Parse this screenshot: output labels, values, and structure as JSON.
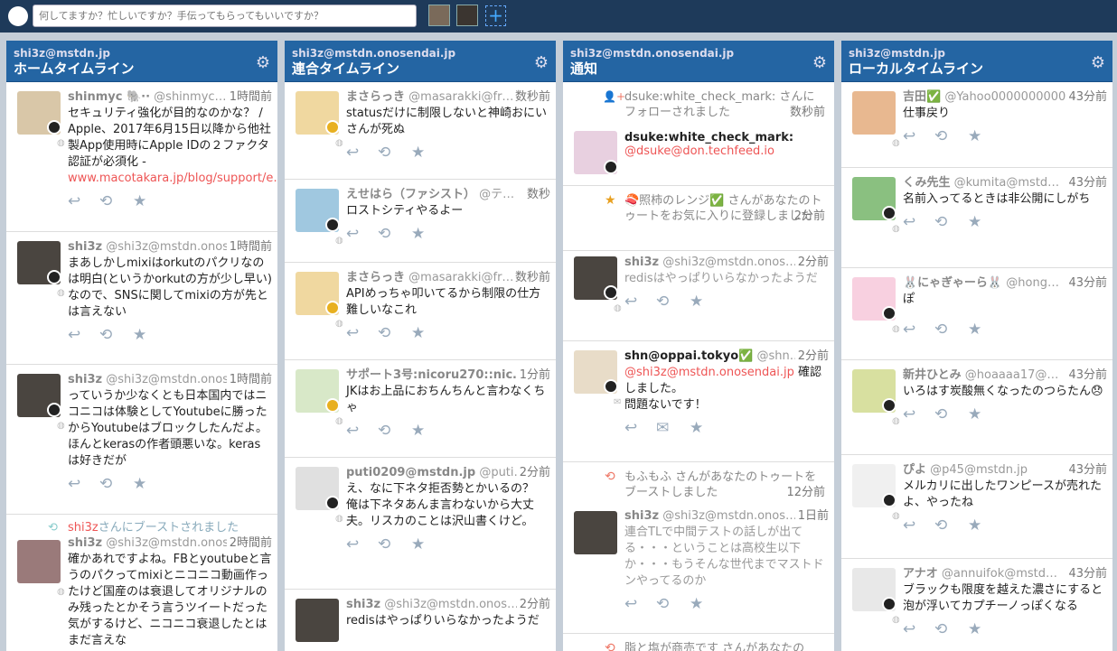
{
  "search": {
    "placeholder": "何してますか？忙しいですか？手伝ってもらってもいいですか？"
  },
  "columns": [
    {
      "account": "shi3z@mstdn.jp",
      "title": "ホームタイムライン"
    },
    {
      "account": "shi3z@mstdn.onosendai.jp",
      "title": "連合タイムライン"
    },
    {
      "account": "shi3z@mstdn.onosendai.jp",
      "title": "通知"
    },
    {
      "account": "shi3z@mstdn.jp",
      "title": "ローカルタイムライン"
    }
  ],
  "home": [
    {
      "name": "shinmyc 🐘··",
      "handle": "@shinmyc…",
      "time": "1時間前",
      "text": "セキュリティ強化が目的なのかな？ / Apple、2017年6月15日以降から他社製App使用時にApple IDの２ファクタ認証が必須化 - ",
      "link": "www.macotakara.jp/blog/support/e…"
    },
    {
      "name": "shi3z",
      "handle": "@shi3z@mstdn.onos…",
      "time": "1時間前",
      "text": "まあしかしmixiはorkutのパクリなのは明白(というかorkutの方が少し早い)なので、SNSに関してmixiの方が先とは言えない"
    },
    {
      "name": "shi3z",
      "handle": "@shi3z@mstdn.onos…",
      "time": "1時間前",
      "text": "っていうか少なくとも日本国内ではニコニコは体験としてYoutubeに勝ったからYoutubeはブロックしたんだよ。ほんとkerasの作者頭悪いな。kerasは好きだが"
    },
    {
      "boost_user": "shi3z",
      "boost_text": "さんにブーストされました",
      "name": "shi3z",
      "handle": "@shi3z@mstdn.onos…",
      "time": "2時間前",
      "text": "確かあれですよね。FBとyoutubeと言うのパクってmixiとニコニコ動画作ったけど国産のは衰退してオリジナルのみ残ったとかそう言うツイートだった気がするけど、ニコニコ衰退したとはまだ言えな"
    }
  ],
  "federated": [
    {
      "name": "まさらっき",
      "handle": "@masarakki@fr…",
      "time": "数秒前",
      "text": "statusだけに制限しないと神崎おにいさんが死ぬ"
    },
    {
      "name": "えせはら（ファシスト）",
      "handle": "@テ…",
      "time": "数秒",
      "text": "ロストシティやるよー"
    },
    {
      "name": "まさらっき",
      "handle": "@masarakki@fr…",
      "time": "数秒前",
      "text": "APIめっちゃ叩いてるから制限の仕方難しいなこれ"
    },
    {
      "name": "サポート3号:nicoru270::nic…",
      "handle": "",
      "time": "1分前",
      "text": "JKはお上品におちんちんと言わなくちゃ"
    },
    {
      "name": "puti0209@mstdn.jp",
      "handle": "@puti…",
      "time": "2分前",
      "text": "え、なに下ネタ拒否勢とかいるの？　俺は下ネタあんま言わないから大丈夫。リスカのことは沢山書くけど。"
    },
    {
      "name": "shi3z",
      "handle": "@shi3z@mstdn.onos…",
      "time": "2分前",
      "text": "redisはやっぱりいらなかったようだ"
    }
  ],
  "notifications": [
    {
      "type": "follow",
      "text": "dsuke:white_check_mark: さんにフォローされました",
      "time": "数秒前"
    },
    {
      "type": "account",
      "name": "dsuke:white_check_mark:",
      "handle": "@dsuke@don.techfeed.io"
    },
    {
      "type": "favourite",
      "text": "🍣照柿のレンジ✅ さんがあなたのトゥートをお気に入りに登録しました",
      "time": "2分前"
    },
    {
      "type": "status",
      "name": "shi3z",
      "handle": "@shi3z@mstdn.onos…",
      "time": "2分前",
      "text": "redisはやっぱりいらなかったようだ"
    },
    {
      "type": "mention",
      "name": "shn@oppai.tokyo✅",
      "handle": "@shn…",
      "time": "2分前",
      "mention": "@shi3z@mstdn.onosendai.jp",
      "text": " 確認しました。\n問題ないです！"
    },
    {
      "type": "reblog",
      "text": "もふもふ さんがあなたのトゥートをブーストしました",
      "time": "12分前"
    },
    {
      "type": "status",
      "name": "shi3z",
      "handle": "@shi3z@mstdn.onos…",
      "time": "1日前",
      "text": "連合TLで中間テストの話しが出てる・・・ということは高校生以下か・・・もうそんな世代までマストドンやってるのか"
    },
    {
      "type": "reblog",
      "text": "脂と塩が商売です さんがあなたの",
      "time": ""
    }
  ],
  "local": [
    {
      "name": "吉田✅",
      "handle": "@Yahoo0000000000…",
      "time": "43分前",
      "text": "仕事戻り"
    },
    {
      "name": "くみ先生",
      "handle": "@kumita@mstd…",
      "time": "43分前",
      "text": "名前入ってるときは非公開にしがち"
    },
    {
      "name": "🐰にゃぎゃーら🐰",
      "handle": "@hong…",
      "time": "43分前",
      "text": "ぽ"
    },
    {
      "name": "新井ひとみ",
      "handle": "@hoaaaa17@…",
      "time": "43分前",
      "text": "いろはす炭酸無くなったのつらたん😞"
    },
    {
      "name": "ぴよ",
      "handle": "@p45@mstdn.jp",
      "time": "43分前",
      "text": "メルカリに出したワンピースが売れたよ、やったね"
    },
    {
      "name": "アナオ",
      "handle": "@annuifok@mstd…",
      "time": "43分前",
      "text": "ブラックも限度を越えた濃さにすると泡が浮いてカプチーノっぽくなる"
    }
  ],
  "icons": {
    "reply": "↩",
    "boost": "⟲",
    "fav": "★",
    "gear": "⚙",
    "add": "+",
    "follow": "👤+",
    "star": "★",
    "reblog": "⟲",
    "dm": "✉"
  },
  "colors": {
    "topbar": "#1e3a5a",
    "header": "#2465a3",
    "link": "#e55"
  }
}
